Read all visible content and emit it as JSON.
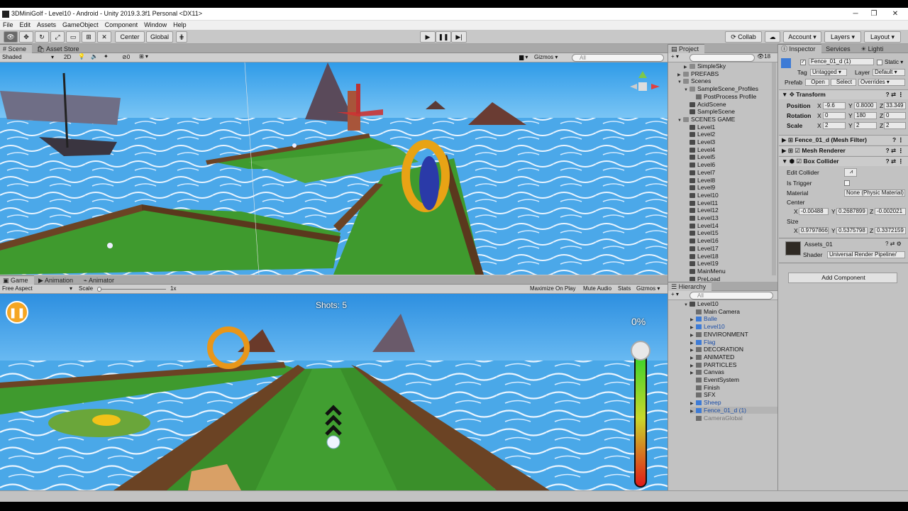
{
  "window": {
    "title": "3DMiniGolf - Level10 - Android - Unity 2019.3.3f1 Personal <DX11>",
    "minimize": "─",
    "maximize": "❐",
    "close": "✕"
  },
  "menu": [
    "File",
    "Edit",
    "Assets",
    "GameObject",
    "Component",
    "Window",
    "Help"
  ],
  "toolbar": {
    "pivot": "Center",
    "space": "Global",
    "collab": "Collab",
    "account": "Account",
    "layers": "Layers",
    "layout": "Layout"
  },
  "scene_panel": {
    "tabs": [
      "Scene",
      "Asset Store"
    ],
    "shading": "Shaded",
    "mode_2d": "2D",
    "fx_count": "0",
    "gizmos": "Gizmos",
    "search_placeholder": "All"
  },
  "game_panel": {
    "tabs": [
      "Game",
      "Animation",
      "Animator"
    ],
    "aspect": "Free Aspect",
    "scale_label": "Scale",
    "scale_value": "1x",
    "toggles": [
      "Maximize On Play",
      "Mute Audio",
      "Stats",
      "Gizmos"
    ],
    "hud_shots": "Shots: 5",
    "hud_power_percent": "0%",
    "power_level": 0
  },
  "project": {
    "title": "Project",
    "count": "18",
    "items": [
      {
        "label": "SimpleSky",
        "depth": 2,
        "type": "folder",
        "fold": "▶"
      },
      {
        "label": "PREFABS",
        "depth": 1,
        "type": "folder",
        "fold": "▶"
      },
      {
        "label": "Scenes",
        "depth": 1,
        "type": "folder",
        "fold": "▼"
      },
      {
        "label": "SampleScene_Profiles",
        "depth": 2,
        "type": "folder",
        "fold": "▼"
      },
      {
        "label": "PostProcess Profile",
        "depth": 3,
        "type": "cube",
        "fold": ""
      },
      {
        "label": "AcidScene",
        "depth": 2,
        "type": "scene",
        "fold": ""
      },
      {
        "label": "SampleScene",
        "depth": 2,
        "type": "scene",
        "fold": ""
      },
      {
        "label": "SCENES GAME",
        "depth": 1,
        "type": "folder",
        "fold": "▼"
      },
      {
        "label": "Level1",
        "depth": 2,
        "type": "scene",
        "fold": ""
      },
      {
        "label": "Level2",
        "depth": 2,
        "type": "scene",
        "fold": ""
      },
      {
        "label": "Level3",
        "depth": 2,
        "type": "scene",
        "fold": ""
      },
      {
        "label": "Level4",
        "depth": 2,
        "type": "scene",
        "fold": ""
      },
      {
        "label": "Level5",
        "depth": 2,
        "type": "scene",
        "fold": ""
      },
      {
        "label": "Level6",
        "depth": 2,
        "type": "scene",
        "fold": ""
      },
      {
        "label": "Level7",
        "depth": 2,
        "type": "scene",
        "fold": ""
      },
      {
        "label": "Level8",
        "depth": 2,
        "type": "scene",
        "fold": ""
      },
      {
        "label": "Level9",
        "depth": 2,
        "type": "scene",
        "fold": ""
      },
      {
        "label": "Level10",
        "depth": 2,
        "type": "scene",
        "fold": ""
      },
      {
        "label": "Level11",
        "depth": 2,
        "type": "scene",
        "fold": ""
      },
      {
        "label": "Level12",
        "depth": 2,
        "type": "scene",
        "fold": ""
      },
      {
        "label": "Level13",
        "depth": 2,
        "type": "scene",
        "fold": ""
      },
      {
        "label": "Level14",
        "depth": 2,
        "type": "scene",
        "fold": ""
      },
      {
        "label": "Level15",
        "depth": 2,
        "type": "scene",
        "fold": ""
      },
      {
        "label": "Level16",
        "depth": 2,
        "type": "scene",
        "fold": ""
      },
      {
        "label": "Level17",
        "depth": 2,
        "type": "scene",
        "fold": ""
      },
      {
        "label": "Level18",
        "depth": 2,
        "type": "scene",
        "fold": ""
      },
      {
        "label": "Level19",
        "depth": 2,
        "type": "scene",
        "fold": ""
      },
      {
        "label": "MainMenu",
        "depth": 2,
        "type": "scene",
        "fold": ""
      },
      {
        "label": "PreLoad",
        "depth": 2,
        "type": "scene",
        "fold": ""
      }
    ]
  },
  "hierarchy": {
    "title": "Hierarchy",
    "search_placeholder": "All",
    "items": [
      {
        "label": "Level10",
        "depth": 0,
        "type": "scene",
        "fold": "▼",
        "style": "normal"
      },
      {
        "label": "Main Camera",
        "depth": 1,
        "type": "cube",
        "fold": "",
        "style": "normal"
      },
      {
        "label": "Balle",
        "depth": 1,
        "type": "prefab",
        "fold": "▶",
        "style": "prefab"
      },
      {
        "label": "Level10",
        "depth": 1,
        "type": "prefab",
        "fold": "▶",
        "style": "prefab"
      },
      {
        "label": "ENVIRONMENT",
        "depth": 1,
        "type": "cube",
        "fold": "▶",
        "style": "normal"
      },
      {
        "label": "Flag",
        "depth": 1,
        "type": "prefab",
        "fold": "▶",
        "style": "prefab"
      },
      {
        "label": "DECORATION",
        "depth": 1,
        "type": "cube",
        "fold": "▶",
        "style": "normal"
      },
      {
        "label": "ANIMATED",
        "depth": 1,
        "type": "cube",
        "fold": "▶",
        "style": "normal"
      },
      {
        "label": "PARTICLES",
        "depth": 1,
        "type": "cube",
        "fold": "▶",
        "style": "normal"
      },
      {
        "label": "Canvas",
        "depth": 1,
        "type": "cube",
        "fold": "▶",
        "style": "normal"
      },
      {
        "label": "EventSystem",
        "depth": 1,
        "type": "cube",
        "fold": "",
        "style": "normal"
      },
      {
        "label": "Finish",
        "depth": 1,
        "type": "cube",
        "fold": "",
        "style": "normal"
      },
      {
        "label": "SFX",
        "depth": 1,
        "type": "cube",
        "fold": "",
        "style": "normal"
      },
      {
        "label": "Sheep",
        "depth": 1,
        "type": "prefab",
        "fold": "▶",
        "style": "prefab"
      },
      {
        "label": "Fence_01_d (1)",
        "depth": 1,
        "type": "prefab",
        "fold": "▶",
        "style": "selected"
      },
      {
        "label": "CameraGlobal",
        "depth": 1,
        "type": "cube",
        "fold": "",
        "style": "disabled"
      }
    ]
  },
  "inspector": {
    "tabs": [
      "Inspector",
      "Services",
      "Lighti"
    ],
    "object_name": "Fence_01_d (1)",
    "static_label": "Static",
    "tag_label": "Tag",
    "tag_value": "Untagged",
    "layer_label": "Layer",
    "layer_value": "Default",
    "prefab_label": "Prefab",
    "prefab_open": "Open",
    "prefab_select": "Select",
    "prefab_overrides": "Overrides",
    "transform": {
      "title": "Transform",
      "position_label": "Position",
      "rotation_label": "Rotation",
      "scale_label": "Scale",
      "position": {
        "x": "-9.6",
        "y": "0.8000",
        "z": "33.349"
      },
      "rotation": {
        "x": "0",
        "y": "180",
        "z": "0"
      },
      "scale": {
        "x": "2",
        "y": "2",
        "z": "2"
      }
    },
    "mesh_filter": "Fence_01_d (Mesh Filter)",
    "mesh_renderer": "Mesh Renderer",
    "box_collider": {
      "title": "Box Collider",
      "edit_collider": "Edit Collider",
      "is_trigger": "Is Trigger",
      "material_label": "Material",
      "material_value": "None (Physic Material)",
      "center_label": "Center",
      "center": {
        "x": "-0.00488",
        "y": "0.2687899",
        "z": "-0.002021"
      },
      "size_label": "Size",
      "size": {
        "x": "0.9797866",
        "y": "0.5375798",
        "z": "0.3372159"
      }
    },
    "material": {
      "name": "Assets_01",
      "shader_label": "Shader",
      "shader_value": "Universal Render Pipeline/"
    },
    "add_component": "Add Component"
  },
  "colors": {
    "editor_bg": "#c2c2c2",
    "sea": "#4aa8e8",
    "grass": "#3f9a2e",
    "wood": "#6b4324",
    "pause": "#f5a623"
  }
}
